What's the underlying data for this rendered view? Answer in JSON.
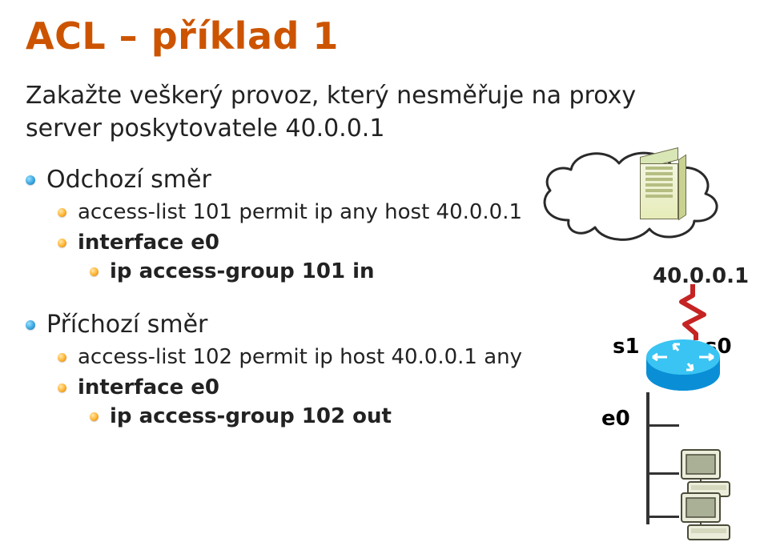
{
  "title": "ACL – příklad 1",
  "intro": "Zakažte veškerý provoz, který nesměřuje na proxy server poskytovatele 40.0.0.1",
  "outgoing": {
    "head": "Odchozí směr",
    "acl": "access-list 101 permit ip any host 40.0.0.1",
    "iface": "interface e0",
    "cmd": "ip access-group 101 in"
  },
  "incoming": {
    "head": "Příchozí směr",
    "acl": "access-list 102 permit ip host 40.0.0.1 any",
    "iface": "interface e0",
    "cmd": "ip access-group 102 out"
  },
  "diagram": {
    "ip": "40.0.0.1",
    "s1": "s1",
    "s0": "s0",
    "e0": "e0"
  }
}
